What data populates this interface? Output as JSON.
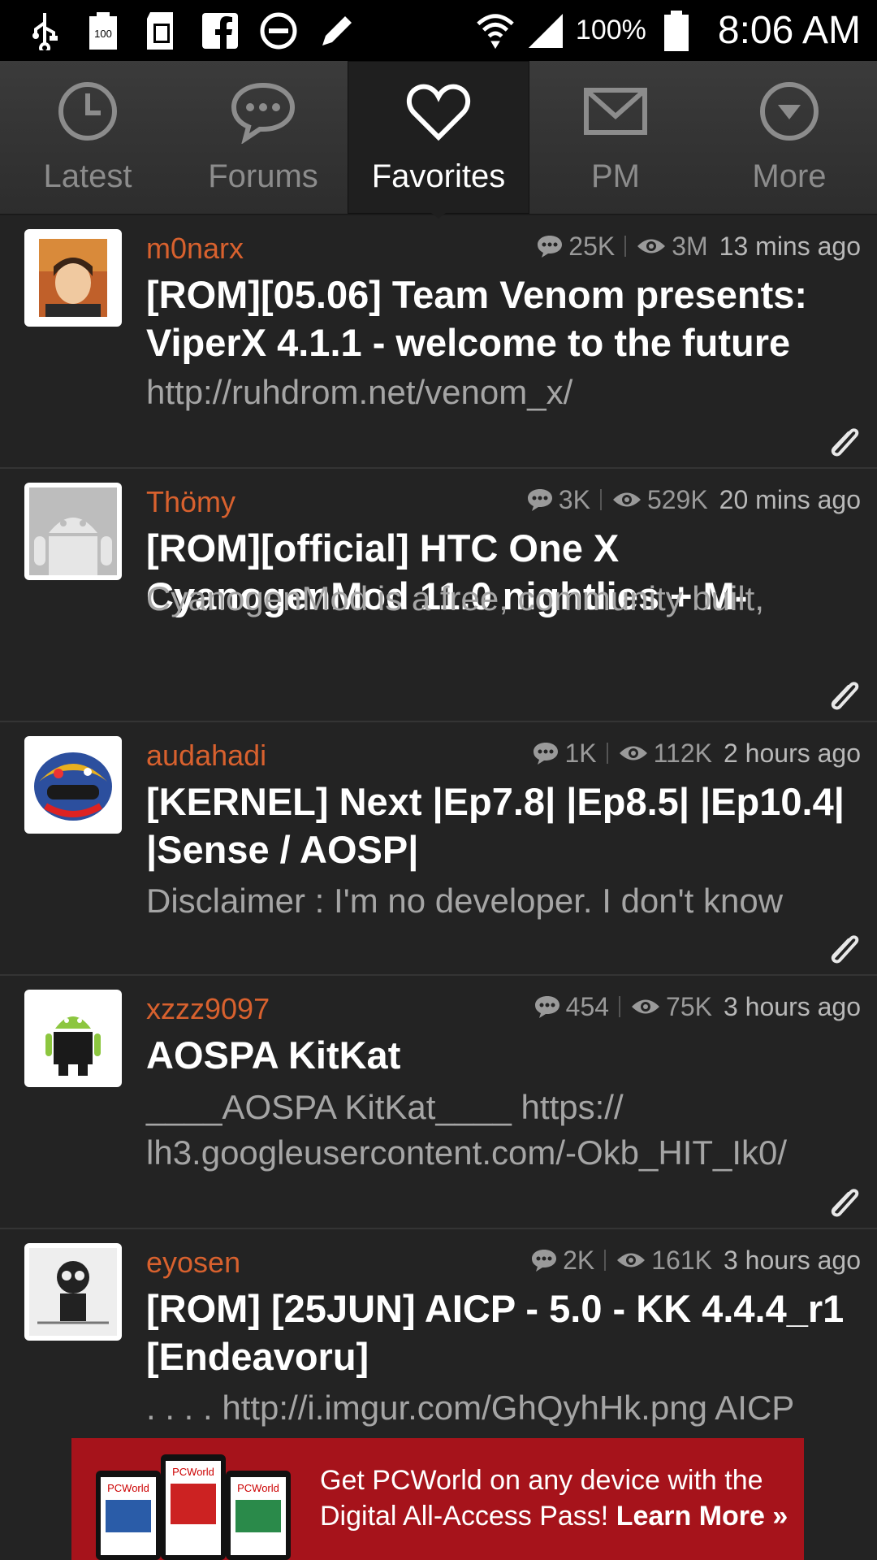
{
  "status_bar": {
    "battery_icon_text": "100",
    "battery_percent": "100%",
    "time": "8:06 AM"
  },
  "tabs": [
    {
      "label": "Latest",
      "icon": "clock-icon"
    },
    {
      "label": "Forums",
      "icon": "chat-bubble-icon"
    },
    {
      "label": "Favorites",
      "icon": "heart-icon"
    },
    {
      "label": "PM",
      "icon": "envelope-icon"
    },
    {
      "label": "More",
      "icon": "dropdown-circle-icon"
    }
  ],
  "active_tab": "Favorites",
  "threads": [
    {
      "author": "m0narx",
      "replies": "25K",
      "views": "3M",
      "time": "13 mins ago",
      "title": "[ROM][05.06] Team Venom presents: ViperX 4.1.1 - welcome to the future",
      "snippet": "http://ruhdrom.net/venom_x/"
    },
    {
      "author": "Thömy",
      "replies": "3K",
      "views": "529K",
      "time": "20 mins ago",
      "title": "[ROM][official] HTC One X CyanogenMod 11.0 nightlies + M-",
      "snippet": "CyanogenMod is a free, community built,"
    },
    {
      "author": "audahadi",
      "replies": "1K",
      "views": "112K",
      "time": "2 hours ago",
      "title": "[KERNEL] Next |Ep7.8| |Ep8.5| |Ep10.4| |Sense / AOSP|",
      "snippet": "Disclaimer : I'm no developer. I don't know"
    },
    {
      "author": "xzzz9097",
      "replies": "454",
      "views": "75K",
      "time": "3 hours ago",
      "title": "AOSPA KitKat",
      "snippet": "____AOSPA KitKat____ https:// lh3.googleusercontent.com/-Okb_HIT_Ik0/"
    },
    {
      "author": "eyosen",
      "replies": "2K",
      "views": "161K",
      "time": "3 hours ago",
      "title": "[ROM] [25JUN] AICP - 5.0 - KK 4.4.4_r1 [Endeavoru]",
      "snippet": ". . . . http://i.imgur.com/GhQyhHk.png AICP"
    }
  ],
  "ad": {
    "line1": "Get PCWorld on any device with the",
    "line2_prefix": "Digital All-Access Pass!",
    "cta": "Learn More »",
    "brand": "PCWorld"
  },
  "colors": {
    "author": "#d8612e",
    "background": "#232323",
    "ad_background": "#a6131b"
  }
}
